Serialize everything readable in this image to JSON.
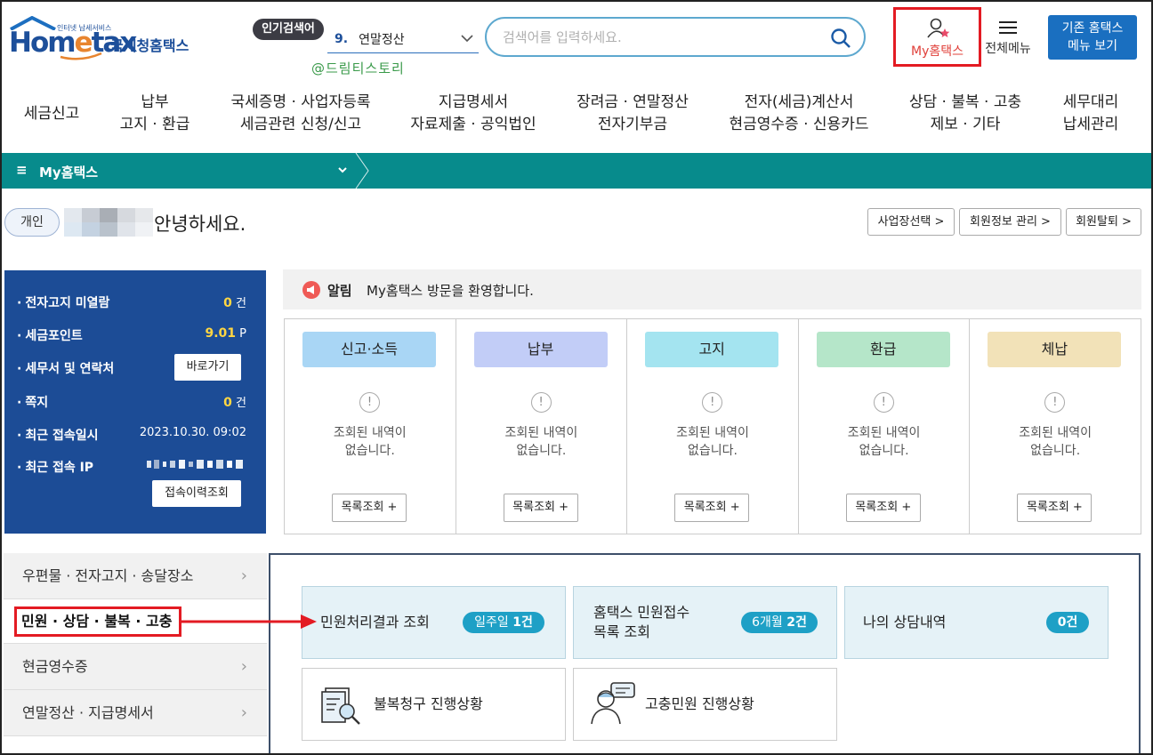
{
  "logo": {
    "small": "인터넷 납세서비스",
    "home": "Hom",
    "e": "e",
    "tax": "tax",
    "kname": "국세청홈택스"
  },
  "header": {
    "popular_label": "인기검색어",
    "popular_num": "9.",
    "popular_term": "연말정산",
    "search_placeholder": "검색어를 입력하세요.",
    "watermark": "@드림티스토리",
    "myhometax_label": "My홈택스",
    "allmenu_label": "전체메뉴",
    "old_home_line1": "기존 홈택스",
    "old_home_line2": "메뉴 보기"
  },
  "gnb": [
    {
      "line1": "세금신고",
      "line2": ""
    },
    {
      "line1": "납부",
      "line2": "고지 · 환급"
    },
    {
      "line1": "국세증명 · 사업자등록",
      "line2": "세금관련 신청/신고"
    },
    {
      "line1": "지급명세서",
      "line2": "자료제출 · 공익법인"
    },
    {
      "line1": "장려금 · 연말정산",
      "line2": "전자기부금"
    },
    {
      "line1": "전자(세금)계산서",
      "line2": "현금영수증 · 신용카드"
    },
    {
      "line1": "상담 · 불복 · 고충",
      "line2": "제보 · 기타"
    },
    {
      "line1": "세무대리",
      "line2": "납세관리"
    }
  ],
  "teal_bar": {
    "menu_symbol": "≡",
    "title": "My홈택스"
  },
  "greeting": {
    "type": "개인",
    "message": "안녕하세요.",
    "buttons": [
      "사업장선택 >",
      "회원정보 관리 >",
      "회원탈퇴 >"
    ]
  },
  "info": {
    "rows": [
      {
        "label": "전자고지 미열람",
        "value": "0",
        "unit": " 건"
      },
      {
        "label": "세금포인트",
        "value": "9.01",
        "unit": " P"
      },
      {
        "label": "세무서 및 연락처",
        "button": "바로가기"
      },
      {
        "label": "쪽지",
        "value": "0",
        "unit": " 건"
      },
      {
        "label": "최근 접속일시",
        "text": "2023.10.30.  09:02"
      },
      {
        "label": "최근 접속 IP",
        "text": ""
      }
    ],
    "history_button": "접속이력조회"
  },
  "notice": {
    "tag": "알림",
    "message": "My홈택스 방문을 환영합니다."
  },
  "cards": [
    {
      "title": "신고·소득",
      "color": "#a9d6f5",
      "empty1": "조회된 내역이",
      "empty2": "없습니다.",
      "button": "목록조회 +"
    },
    {
      "title": "납부",
      "color": "#c2cdf7",
      "empty1": "조회된 내역이",
      "empty2": "없습니다.",
      "button": "목록조회 +"
    },
    {
      "title": "고지",
      "color": "#a4e4f0",
      "empty1": "조회된 내역이",
      "empty2": "없습니다.",
      "button": "목록조회 +"
    },
    {
      "title": "환급",
      "color": "#b5e6c9",
      "empty1": "조회된 내역이",
      "empty2": "없습니다.",
      "button": "목록조회 +"
    },
    {
      "title": "체납",
      "color": "#f2e2b8",
      "empty1": "조회된 내역이",
      "empty2": "없습니다.",
      "button": "목록조회 +"
    }
  ],
  "left_nav": [
    {
      "label": "우편물 · 전자고지 · 송달장소"
    },
    {
      "label": "민원 · 상담 · 불복 · 고충"
    },
    {
      "label": "현금영수증"
    },
    {
      "label": "연말정산 · 지급명세서"
    }
  ],
  "tiles": {
    "t1": {
      "label": "민원처리결과 조회",
      "pill_text": "일주일 ",
      "pill_bold": "1건"
    },
    "t2": {
      "label1": "홈택스 민원접수",
      "label2": "목록 조회",
      "pill_text": "6개월 ",
      "pill_bold": "2건"
    },
    "t3": {
      "label": "나의 상담내역",
      "pill_bold": "0건"
    },
    "t4": {
      "label": "불복청구 진행상황"
    },
    "t5": {
      "label": "고충민원 진행상황"
    }
  }
}
